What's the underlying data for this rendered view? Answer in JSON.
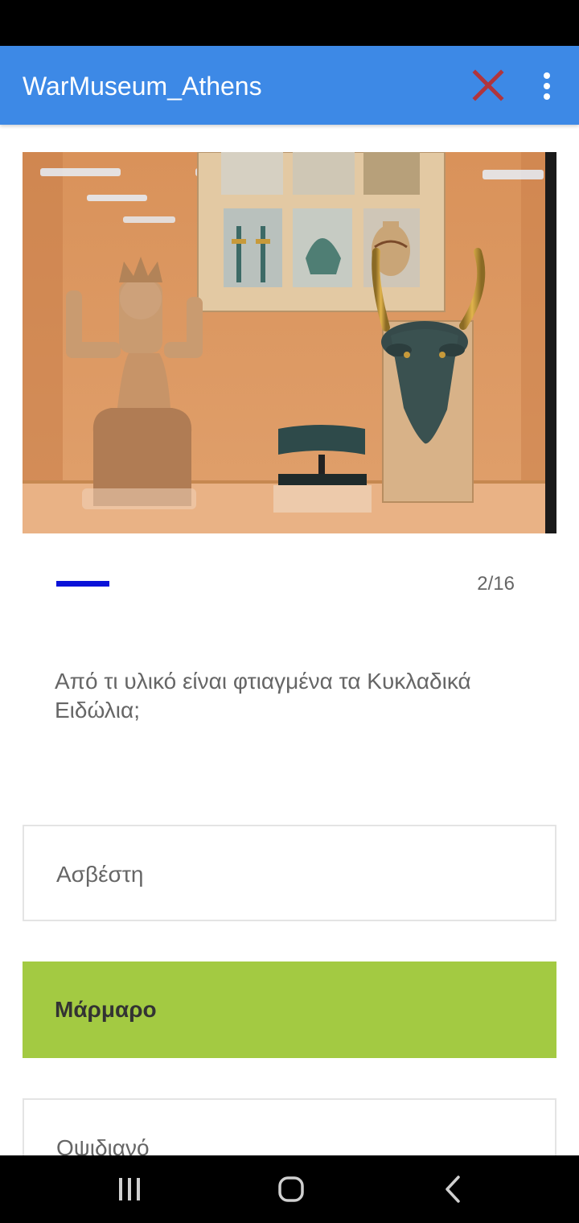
{
  "app_bar": {
    "title": "WarMuseum_Athens",
    "close_icon": "close-icon",
    "close_color": "#b0353d",
    "more_icon": "more-vert-icon",
    "background": "#3d89e6"
  },
  "quiz": {
    "image_icon": "museum-exhibit-photo",
    "progress_fraction": 0.125,
    "progress_color": "#0a12d8",
    "counter": "2/16",
    "question": "Από τι υλικό είναι φτιαγμένα τα Κυκλαδικά Ειδώλια;",
    "answers": [
      {
        "label": "Ασβέστη",
        "selected": false
      },
      {
        "label": "Μάρμαρο",
        "selected": true
      },
      {
        "label": "Οψιδιανό",
        "selected": false
      }
    ],
    "selected_color": "#a3ca42"
  },
  "nav_bar": {
    "recents_icon": "recents-icon",
    "home_icon": "home-icon",
    "back_icon": "back-icon"
  }
}
